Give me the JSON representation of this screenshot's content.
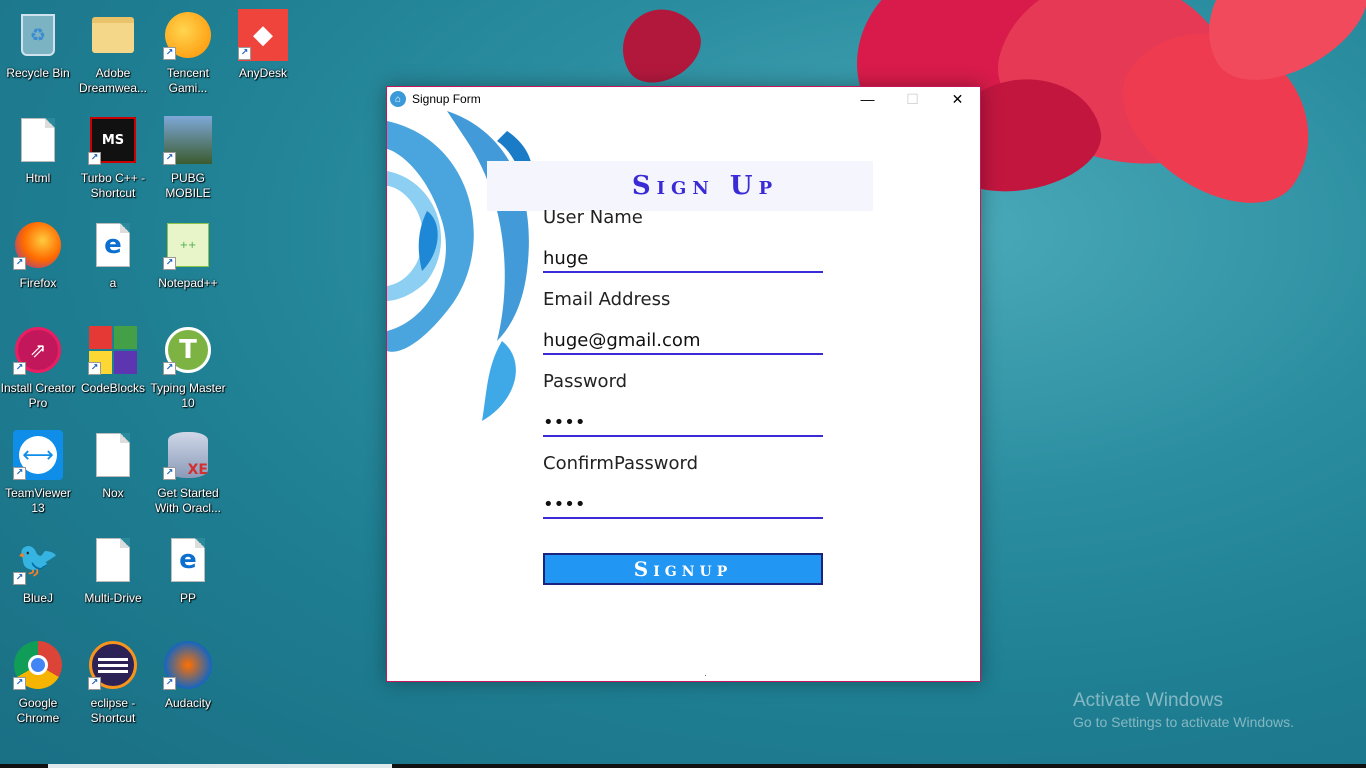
{
  "desktop": {
    "icons": [
      {
        "label": "Recycle Bin",
        "icon": "recycle-bin-icon"
      },
      {
        "label": "Adobe Dreamwea...",
        "icon": "folder-icon"
      },
      {
        "label": "Tencent Gami...",
        "icon": "tencent-gaming-icon"
      },
      {
        "label": "AnyDesk",
        "icon": "anydesk-icon"
      },
      {
        "label": "Html",
        "icon": "document-icon"
      },
      {
        "label": "Turbo C++ - Shortcut",
        "icon": "turbo-cpp-icon"
      },
      {
        "label": "PUBG MOBILE",
        "icon": "pubg-icon"
      },
      {
        "label": "Firefox",
        "icon": "firefox-icon"
      },
      {
        "label": "a",
        "icon": "edge-file-icon"
      },
      {
        "label": "Notepad++",
        "icon": "notepad-plus-plus-icon"
      },
      {
        "label": "Install Creator Pro",
        "icon": "install-creator-icon"
      },
      {
        "label": "CodeBlocks",
        "icon": "codeblocks-icon"
      },
      {
        "label": "Typing Master 10",
        "icon": "typing-master-icon"
      },
      {
        "label": "TeamViewer 13",
        "icon": "teamviewer-icon"
      },
      {
        "label": "Nox",
        "icon": "document-icon"
      },
      {
        "label": "Get Started With Oracl...",
        "icon": "oracle-xe-icon"
      },
      {
        "label": "BlueJ",
        "icon": "bluej-icon"
      },
      {
        "label": "Multi-Drive",
        "icon": "document-icon"
      },
      {
        "label": "PP",
        "icon": "edge-file-icon"
      },
      {
        "label": "Google Chrome",
        "icon": "chrome-icon"
      },
      {
        "label": "eclipse - Shortcut",
        "icon": "eclipse-icon"
      },
      {
        "label": "Audacity",
        "icon": "audacity-icon"
      }
    ]
  },
  "window": {
    "title": "Signup Form",
    "minimize": "—",
    "maximize": "☐",
    "close": "✕"
  },
  "form": {
    "heading": "Sign Up",
    "username_label": "User Name",
    "username_value": "huge",
    "email_label": "Email Address",
    "email_value": "huge@gmail.com",
    "password_label": "Password",
    "password_value": "••••",
    "confirm_label": "ConfirmPassword",
    "confirm_value": "••••",
    "submit_label": "Signup"
  },
  "watermark": {
    "line1": "Activate Windows",
    "line2": "Go to Settings to activate Windows."
  }
}
